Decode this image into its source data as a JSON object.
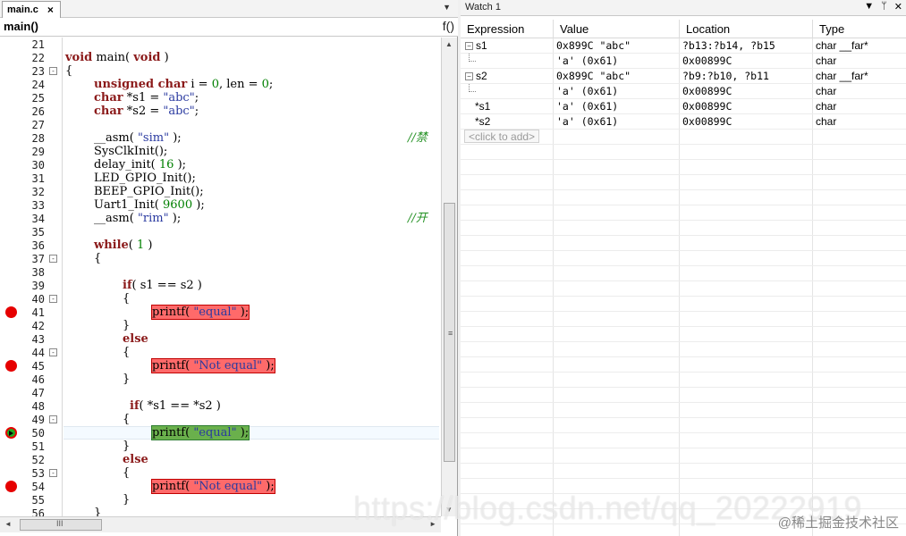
{
  "editor": {
    "tab_label": "main.c",
    "tab_close": "×",
    "tab_dropdown": "▼",
    "function_name": "main()",
    "function_icon": "f()",
    "lines": [
      {
        "n": "21",
        "fold": "",
        "bp": ""
      },
      {
        "n": "22",
        "fold": "",
        "bp": ""
      },
      {
        "n": "23",
        "fold": "-",
        "bp": ""
      },
      {
        "n": "24",
        "fold": "",
        "bp": ""
      },
      {
        "n": "25",
        "fold": "",
        "bp": ""
      },
      {
        "n": "26",
        "fold": "",
        "bp": ""
      },
      {
        "n": "27",
        "fold": "",
        "bp": ""
      },
      {
        "n": "28",
        "fold": "",
        "bp": ""
      },
      {
        "n": "29",
        "fold": "",
        "bp": ""
      },
      {
        "n": "30",
        "fold": "",
        "bp": ""
      },
      {
        "n": "31",
        "fold": "",
        "bp": ""
      },
      {
        "n": "32",
        "fold": "",
        "bp": ""
      },
      {
        "n": "33",
        "fold": "",
        "bp": ""
      },
      {
        "n": "34",
        "fold": "",
        "bp": ""
      },
      {
        "n": "35",
        "fold": "",
        "bp": ""
      },
      {
        "n": "36",
        "fold": "",
        "bp": ""
      },
      {
        "n": "37",
        "fold": "-",
        "bp": ""
      },
      {
        "n": "38",
        "fold": "",
        "bp": ""
      },
      {
        "n": "39",
        "fold": "",
        "bp": ""
      },
      {
        "n": "40",
        "fold": "-",
        "bp": ""
      },
      {
        "n": "41",
        "fold": "",
        "bp": "red"
      },
      {
        "n": "42",
        "fold": "",
        "bp": ""
      },
      {
        "n": "43",
        "fold": "",
        "bp": ""
      },
      {
        "n": "44",
        "fold": "-",
        "bp": ""
      },
      {
        "n": "45",
        "fold": "",
        "bp": "red"
      },
      {
        "n": "46",
        "fold": "",
        "bp": ""
      },
      {
        "n": "47",
        "fold": "",
        "bp": ""
      },
      {
        "n": "48",
        "fold": "",
        "bp": ""
      },
      {
        "n": "49",
        "fold": "-",
        "bp": ""
      },
      {
        "n": "50",
        "fold": "",
        "bp": "current"
      },
      {
        "n": "51",
        "fold": "",
        "bp": ""
      },
      {
        "n": "52",
        "fold": "",
        "bp": ""
      },
      {
        "n": "53",
        "fold": "-",
        "bp": ""
      },
      {
        "n": "54",
        "fold": "",
        "bp": "red"
      },
      {
        "n": "55",
        "fold": "",
        "bp": ""
      },
      {
        "n": "56",
        "fold": "",
        "bp": ""
      }
    ],
    "code": {
      "l22_kw1": "void",
      "l22_mid": " main( ",
      "l22_kw2": "void",
      "l22_end": " )",
      "l23": "{",
      "l24_kw": "unsigned char",
      "l24_a": " i = ",
      "l24_n1": "0",
      "l24_b": ", len = ",
      "l24_n2": "0",
      "l24_c": ";",
      "l25_kw": "char",
      "l25_a": " *s1 = ",
      "l25_s": "\"abc\"",
      "l25_c": ";",
      "l26_kw": "char",
      "l26_a": " *s2 = ",
      "l26_s": "\"abc\"",
      "l26_c": ";",
      "l28_a": "__asm( ",
      "l28_s": "\"sim\"",
      "l28_b": " );",
      "l28_cmt": "//禁",
      "l29": "SysClkInit();",
      "l30_a": "delay_init( ",
      "l30_n": "16",
      "l30_b": " );",
      "l31": "LED_GPIO_Init();",
      "l32": "BEEP_GPIO_Init();",
      "l33_a": "Uart1_Init( ",
      "l33_n": "9600",
      "l33_b": " );",
      "l34_a": "__asm( ",
      "l34_s": "\"rim\"",
      "l34_b": " );",
      "l34_cmt": "//开",
      "l36_kw": "while",
      "l36_a": "( ",
      "l36_n": "1",
      "l36_b": " )",
      "l37": "{",
      "l39_kw": "if",
      "l39_a": "( s1 == s2 )",
      "l40": "{",
      "l41_a": "printf( ",
      "l41_s": "\"equal\"",
      "l41_b": " );",
      "l42": "}",
      "l43_kw": "else",
      "l44": "{",
      "l45_a": "printf( ",
      "l45_s": "\"Not equal\"",
      "l45_b": " );",
      "l46": "}",
      "l48_kw": "if",
      "l48_a": "( *s1 == *s2 )",
      "l49": "{",
      "l50_a": "printf( ",
      "l50_s": "\"equal\"",
      "l50_b": " );",
      "l51": "}",
      "l52_kw": "else",
      "l53": "{",
      "l54_a": "printf( ",
      "l54_s": "\"Not equal\"",
      "l54_b": " );",
      "l55": "}",
      "l56": "}"
    }
  },
  "scrollbars": {
    "up": "▲",
    "down": "▼",
    "left": "◄",
    "right": "►",
    "vgrip": "≡",
    "hgrip": "III"
  },
  "watch": {
    "title": "Watch 1",
    "ctrl_dropdown": "▼",
    "ctrl_pin": "ᛘ",
    "ctrl_close": "✕",
    "columns": [
      "Expression",
      "Value",
      "Location",
      "Type"
    ],
    "rows": [
      {
        "expr": "s1",
        "value": "0x899C \"abc\"",
        "location": "?b13:?b14, ?b15",
        "type": "char __far*",
        "kind": "parent"
      },
      {
        "expr": "",
        "value": "'a' (0x61)",
        "location": "0x00899C",
        "type": "char",
        "kind": "child"
      },
      {
        "expr": "s2",
        "value": "0x899C \"abc\"",
        "location": "?b9:?b10, ?b11",
        "type": "char __far*",
        "kind": "parent"
      },
      {
        "expr": "",
        "value": "'a' (0x61)",
        "location": "0x00899C",
        "type": "char",
        "kind": "child"
      },
      {
        "expr": "*s1",
        "value": "'a' (0x61)",
        "location": "0x00899C",
        "type": "char",
        "kind": "plain"
      },
      {
        "expr": "*s2",
        "value": "'a' (0x61)",
        "location": "0x00899C",
        "type": "char",
        "kind": "plain"
      }
    ],
    "add_placeholder": "<click to add>"
  },
  "overlay": {
    "watermark": "https://blog.csdn.net/qq_20222919",
    "site_badge": "@稀土掘金技术社区"
  }
}
